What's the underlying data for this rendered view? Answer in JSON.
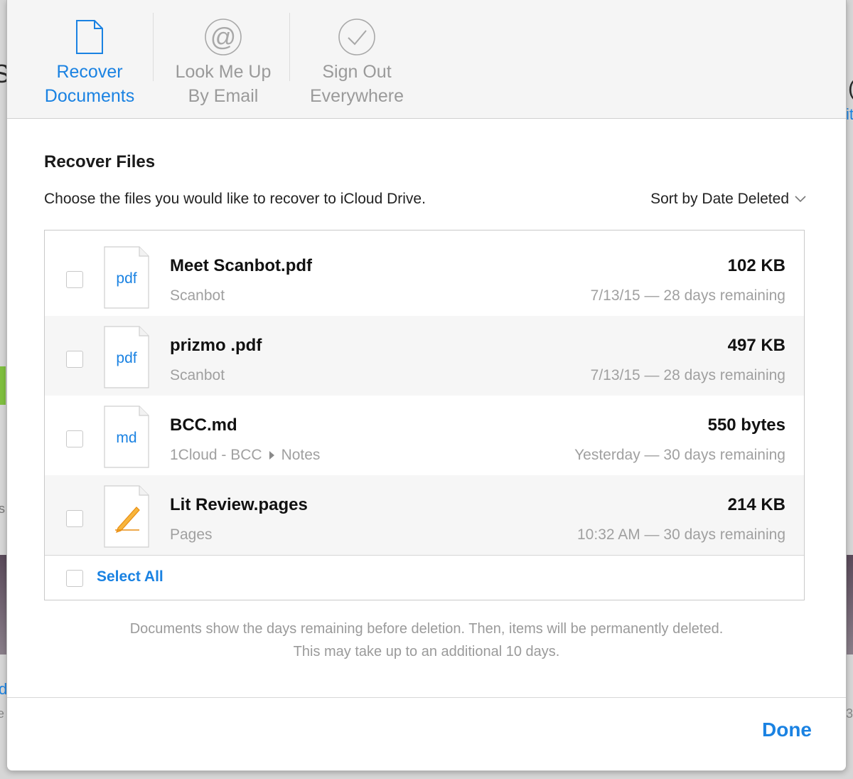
{
  "background": {
    "fragment_left_top": "S",
    "fragment_right_top": "(",
    "fragment_right_link": "it",
    "fragment_left_link": "d",
    "fragment_left_mid": "s",
    "fragment_left_bottom": "e",
    "fragment_right_bottom": "3"
  },
  "toolbar": {
    "items": [
      {
        "label": "Recover\nDocuments",
        "icon": "document-icon",
        "active": true
      },
      {
        "label": "Look Me Up\nBy Email",
        "icon": "at-sign-icon",
        "active": false
      },
      {
        "label": "Sign Out\nEverywhere",
        "icon": "checkmark-circle-icon",
        "active": false
      }
    ]
  },
  "main": {
    "title": "Recover Files",
    "subtitle": "Choose the files you would like to recover to iCloud Drive.",
    "sort_label": "Sort by Date Deleted",
    "files": [
      {
        "name": "Meet Scanbot.pdf",
        "ext": "pdf",
        "location": "Scanbot",
        "location_sub": "",
        "size": "102 KB",
        "deleted": "7/13/15 — 28 days remaining"
      },
      {
        "name": "prizmo .pdf",
        "ext": "pdf",
        "location": "Scanbot",
        "location_sub": "",
        "size": "497 KB",
        "deleted": "7/13/15 — 28 days remaining"
      },
      {
        "name": "BCC.md",
        "ext": "md",
        "location": "1Cloud - BCC",
        "location_sub": "Notes",
        "size": "550 bytes",
        "deleted": "Yesterday — 30 days remaining"
      },
      {
        "name": "Lit Review.pages",
        "ext": "",
        "location": "Pages",
        "location_sub": "",
        "size": "214 KB",
        "deleted": "10:32 AM — 30 days remaining"
      }
    ],
    "select_all": "Select All",
    "note_line1": "Documents show the days remaining before deletion. Then, items will be permanently deleted.",
    "note_line2": "This may take up to an additional 10 days.",
    "done": "Done"
  },
  "colors": {
    "accent": "#1a82e2",
    "muted_text": "#9a9a9a",
    "pages_icon": "#f29d1f"
  }
}
